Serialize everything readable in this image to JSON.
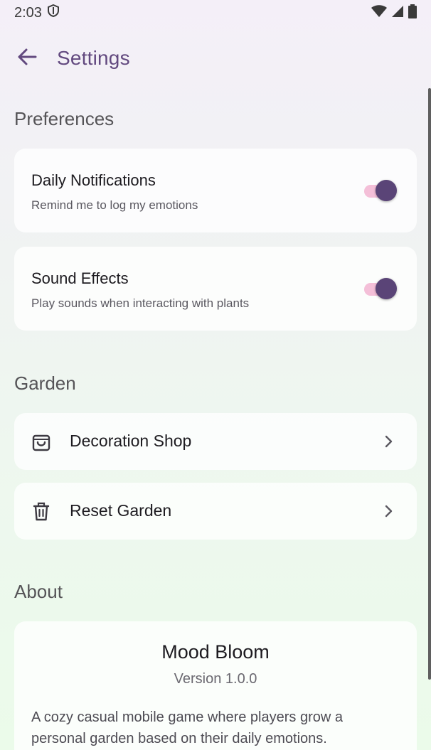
{
  "status_bar": {
    "time": "2:03",
    "icons": [
      "shield-icon",
      "wifi-icon",
      "cell-signal-icon",
      "battery-icon"
    ]
  },
  "topbar": {
    "back_icon": "arrow-back-icon",
    "title": "Settings"
  },
  "sections": {
    "preferences": {
      "title": "Preferences",
      "items": [
        {
          "title": "Daily Notifications",
          "subtitle": "Remind me to log my emotions",
          "enabled": true
        },
        {
          "title": "Sound Effects",
          "subtitle": "Play sounds when interacting with plants",
          "enabled": true
        }
      ]
    },
    "garden": {
      "title": "Garden",
      "items": [
        {
          "label": "Decoration Shop",
          "icon": "shopping-bag-icon"
        },
        {
          "label": "Reset Garden",
          "icon": "trash-icon"
        }
      ]
    },
    "about": {
      "title": "About",
      "app_name": "Mood Bloom",
      "version": "Version 1.0.0",
      "description": "A cozy casual mobile game where players grow a personal garden based on their daily emotions."
    }
  },
  "colors": {
    "accent": "#62497f",
    "switch_thumb": "#5a4477",
    "switch_track": "#f4bfd8"
  }
}
